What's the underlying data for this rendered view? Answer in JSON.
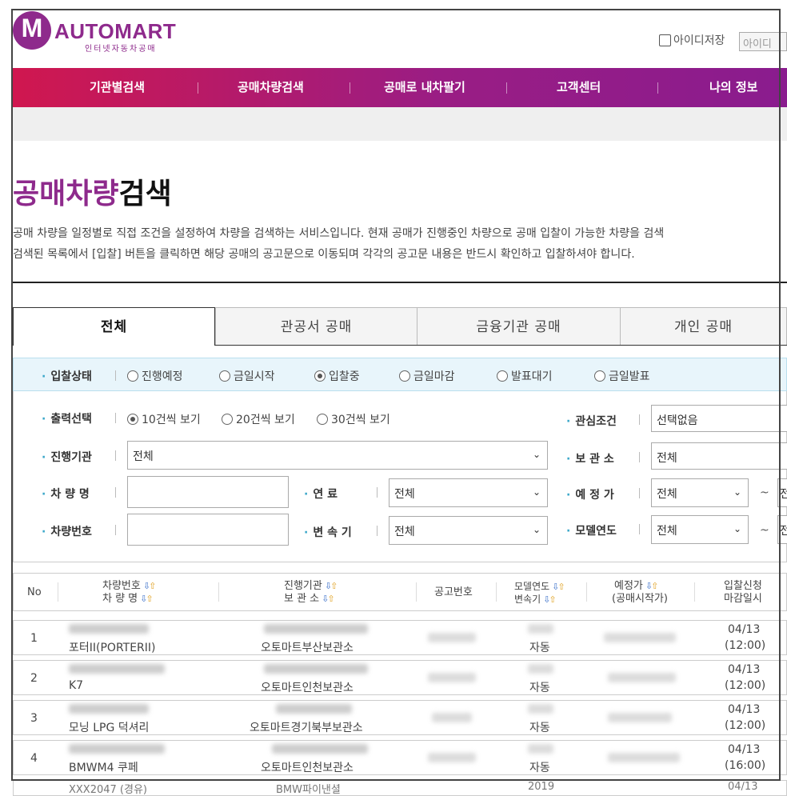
{
  "header": {
    "logo_letter": "M",
    "logo_name": "AUTOMART",
    "logo_subtitle": "인터넷자동차공매",
    "remember_id_label": "아이디저장",
    "id_placeholder": "아이디"
  },
  "nav": {
    "items": [
      "기관별검색",
      "공매차량검색",
      "공매로 내차팔기",
      "고객센터",
      "나의 정보"
    ]
  },
  "page": {
    "title_part1": "공매차량",
    "title_part2": "검색",
    "description_line1": "공매 차량을 일정별로 직접 조건을 설정하여 차량을 검색하는 서비스입니다. 현재 공매가 진행중인 차량으로 공매 입찰이 가능한 차량을 검색",
    "description_line2": "검색된 목록에서 [입찰] 버튼을 클릭하면 해당 공매의 공고문으로 이동되며 각각의 공고문 내용은 반드시 확인하고 입찰하셔야 합니다."
  },
  "tabs": [
    "전체",
    "관공서 공매",
    "금융기관 공매",
    "개인 공매"
  ],
  "filters": {
    "bid_status_label": "입찰상태",
    "bid_status_options": [
      "진행예정",
      "금일시작",
      "입찰중",
      "금일마감",
      "발표대기",
      "금일발표"
    ],
    "bid_status_selected": "입찰중",
    "output_label": "출력선택",
    "output_options": [
      "10건씩 보기",
      "20건씩 보기",
      "30건씩 보기"
    ],
    "output_selected": "10건씩 보기",
    "interest_label": "관심조건",
    "interest_value": "선택없음",
    "agency_label": "진행기관",
    "agency_value": "전체",
    "storage_label": "보 관 소",
    "storage_value": "전체",
    "car_name_label": "차 량 명",
    "fuel_label": "연    료",
    "fuel_value": "전체",
    "est_price_label": "예 정 가",
    "est_price_value": "전체",
    "est_price_value_to": "전",
    "car_number_label": "차량번호",
    "transmission_label": "변 속 기",
    "transmission_value": "전체",
    "model_year_label": "모델연도",
    "model_year_value": "전체",
    "model_year_value_to": "전",
    "tilde": "~"
  },
  "table": {
    "headers": {
      "no": "No",
      "car_number": "차량번호",
      "car_name": "차 량 명",
      "agency": "진행기관",
      "storage": "보 관 소",
      "notice": "공고번호",
      "model_year": "모델연도",
      "transmission": "변속기",
      "est_price": "예정가",
      "start_price": "(공매시작가)",
      "bid_apply": "입찰신청",
      "deadline": "마감일시"
    },
    "rows": [
      {
        "no": "1",
        "car_name": "포터II(PORTERII)",
        "storage": "오토마트부산보관소",
        "transmission": "자동",
        "date": "04/13",
        "time": "(12:00)"
      },
      {
        "no": "2",
        "car_name": "K7",
        "storage": "오토마트인천보관소",
        "transmission": "자동",
        "date": "04/13",
        "time": "(12:00)"
      },
      {
        "no": "3",
        "car_name": "모닝 LPG 덕셔리",
        "storage": "오토마트경기북부보관소",
        "transmission": "자동",
        "date": "04/13",
        "time": "(12:00)"
      },
      {
        "no": "4",
        "car_name": "BMWM4 쿠페",
        "storage": "오토마트인천보관소",
        "transmission": "자동",
        "date": "04/13",
        "time": "(16:00)"
      }
    ],
    "partial_row": {
      "car_name": "XXX2047 (경유)",
      "storage": "BMW파이낸셜",
      "year": "2019",
      "date": "04/13"
    }
  }
}
